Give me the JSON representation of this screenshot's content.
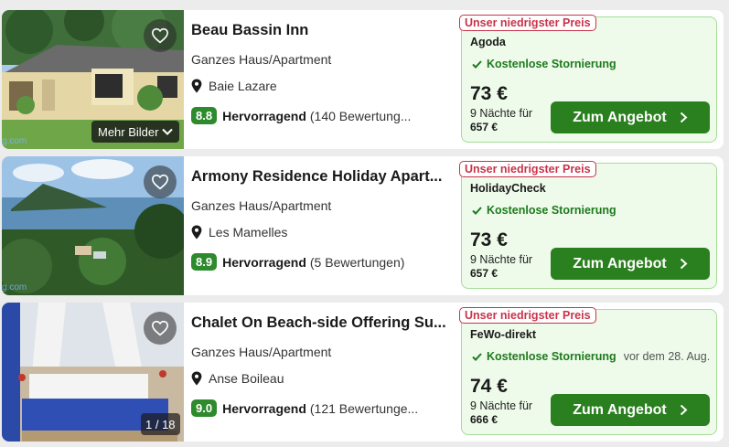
{
  "listings": [
    {
      "name": "Beau Bassin Inn",
      "type": "Ganzes Haus/Apartment",
      "location": "Baie Lazare",
      "score": "8.8",
      "rating_label": "Hervorragend",
      "reviews": "(140 Bewertung...",
      "photo_action": "Mehr Bilder",
      "watermark": "g.com",
      "deal": {
        "badge": "Unser niedrigster Preis",
        "provider": "Agoda",
        "cancellation": "Kostenlose Stornierung",
        "cancellation_note": "",
        "price": "73 €",
        "nights": "9 Nächte für",
        "total": "657 €",
        "cta": "Zum Angebot"
      }
    },
    {
      "name": "Armony Residence Holiday Apart...",
      "type": "Ganzes Haus/Apartment",
      "location": "Les Mamelles",
      "score": "8.9",
      "rating_label": "Hervorragend",
      "reviews": "(5 Bewertungen)",
      "watermark": "g.com",
      "deal": {
        "badge": "Unser niedrigster Preis",
        "provider": "HolidayCheck",
        "cancellation": "Kostenlose Stornierung",
        "cancellation_note": "",
        "price": "73 €",
        "nights": "9 Nächte für",
        "total": "657 €",
        "cta": "Zum Angebot"
      }
    },
    {
      "name": "Chalet On Beach-side Offering Su...",
      "type": "Ganzes Haus/Apartment",
      "location": "Anse Boileau",
      "score": "9.0",
      "rating_label": "Hervorragend",
      "reviews": "(121 Bewertunge...",
      "photo_counter": "1 / 18",
      "deal": {
        "badge": "Unser niedrigster Preis",
        "provider": "FeWo-direkt",
        "cancellation": "Kostenlose Stornierung",
        "cancellation_note": "vor dem 28. Aug.",
        "price": "74 €",
        "nights": "9 Nächte für",
        "total": "666 €",
        "cta": "Zum Angebot"
      }
    }
  ],
  "colors": {
    "cta_green": "#2a7f1e",
    "deal_bg": "#eefbea",
    "badge_red": "#c8334a",
    "score_green": "#2d8a2d"
  },
  "icons": [
    "heart-icon",
    "location-pin-icon",
    "checkmark-icon",
    "chevron-right-icon",
    "chevron-down-icon"
  ]
}
